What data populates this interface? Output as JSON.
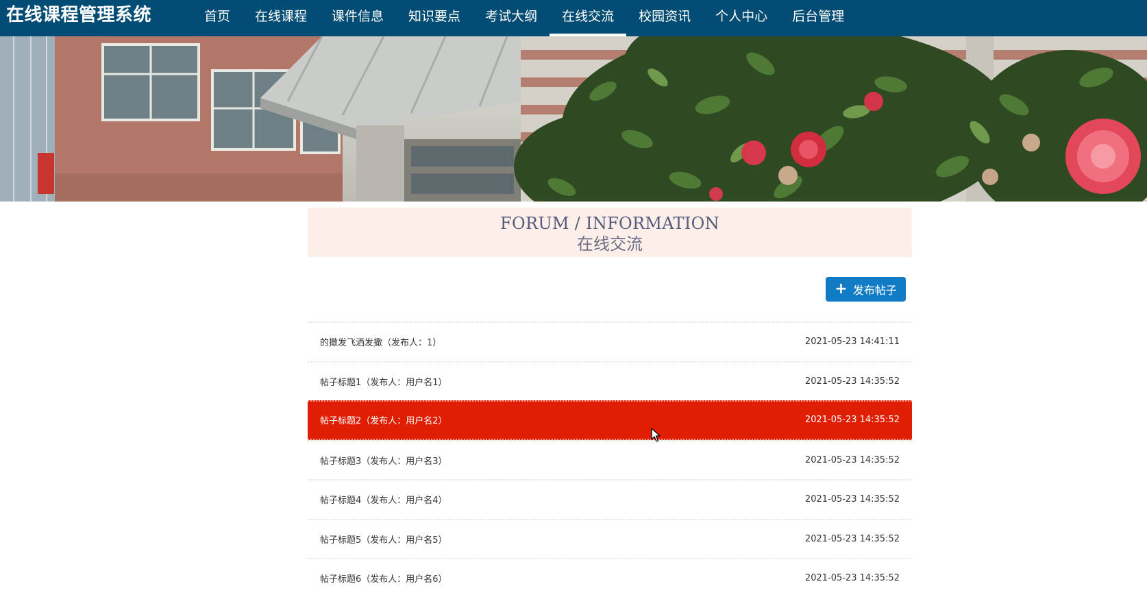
{
  "header": {
    "brand": "在线课程管理系统",
    "nav": [
      {
        "label": "首页",
        "active": false
      },
      {
        "label": "在线课程",
        "active": false
      },
      {
        "label": "课件信息",
        "active": false
      },
      {
        "label": "知识要点",
        "active": false
      },
      {
        "label": "考试大纲",
        "active": false
      },
      {
        "label": "在线交流",
        "active": true
      },
      {
        "label": "校园资讯",
        "active": false
      },
      {
        "label": "个人中心",
        "active": false
      },
      {
        "label": "后台管理",
        "active": false
      }
    ]
  },
  "banner": {
    "slide_count": 3,
    "active_slide": 1
  },
  "section": {
    "title_en": "FORUM / INFORMATION",
    "title_cn": "在线交流"
  },
  "actions": {
    "post_label": "发布帖子"
  },
  "posts": [
    {
      "title": "的撒发飞洒发撒（发布人：1）",
      "time": "2021-05-23 14:41:11"
    },
    {
      "title": "帖子标题1（发布人：用户名1）",
      "time": "2021-05-23 14:35:52"
    },
    {
      "title": "帖子标题2（发布人：用户名2）",
      "time": "2021-05-23 14:35:52"
    },
    {
      "title": "帖子标题3（发布人：用户名3）",
      "time": "2021-05-23 14:35:52"
    },
    {
      "title": "帖子标题4（发布人：用户名4）",
      "time": "2021-05-23 14:35:52"
    },
    {
      "title": "帖子标题5（发布人：用户名5）",
      "time": "2021-05-23 14:35:52"
    },
    {
      "title": "帖子标题6（发布人：用户名6）",
      "time": "2021-05-23 14:35:52"
    }
  ],
  "hovered_post_index": 2,
  "colors": {
    "nav_bg": "#034d75",
    "title_bg": "#fcefe9",
    "button_bg": "#127bc6",
    "hover_row": "#df1e04"
  }
}
